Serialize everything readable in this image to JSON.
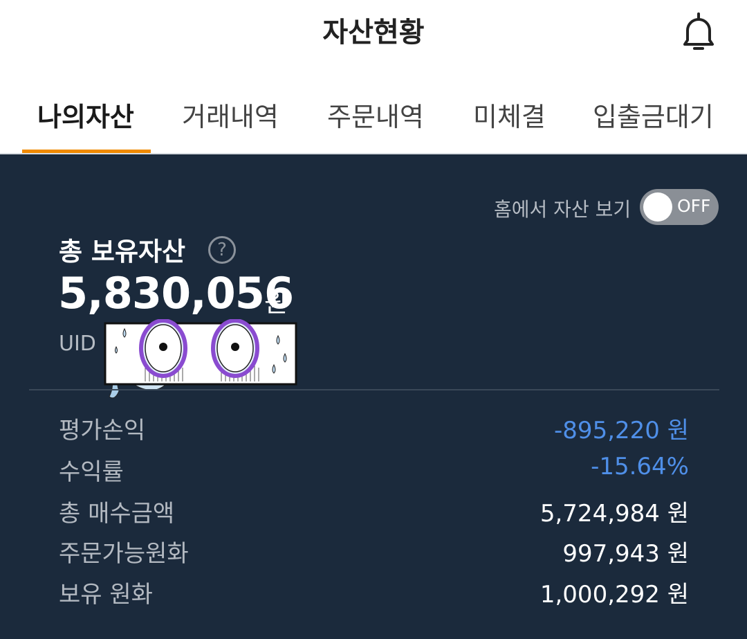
{
  "header": {
    "title": "자산현황",
    "bell_icon": "bell-icon"
  },
  "tabs": [
    {
      "label": "나의자산",
      "active": true
    },
    {
      "label": "거래내역",
      "active": false
    },
    {
      "label": "주문내역",
      "active": false
    },
    {
      "label": "미체결",
      "active": false
    },
    {
      "label": "입출금대기",
      "active": false
    }
  ],
  "colors": {
    "accent_tab": "#f08a00",
    "panel_bg": "#1b2a3c",
    "negative": "#4f8fe8"
  },
  "home_toggle": {
    "label": "홈에서 자산 보기",
    "state": "OFF"
  },
  "summary": {
    "total_label": "총 보유자산",
    "help_icon": "question-icon",
    "total_amount": "5,830,056",
    "total_unit": "원",
    "uid_label": "UID"
  },
  "details": [
    {
      "label": "평가손익",
      "value": "-895,220 원",
      "negative": true
    },
    {
      "label": "수익률",
      "value": "-15.64%",
      "negative": true
    },
    {
      "label": "총 매수금액",
      "value": "5,724,984 원",
      "negative": false
    },
    {
      "label": "주문가능원화",
      "value": "997,943 원",
      "negative": false
    },
    {
      "label": "보유 원화",
      "value": "1,000,292 원",
      "negative": false
    }
  ]
}
